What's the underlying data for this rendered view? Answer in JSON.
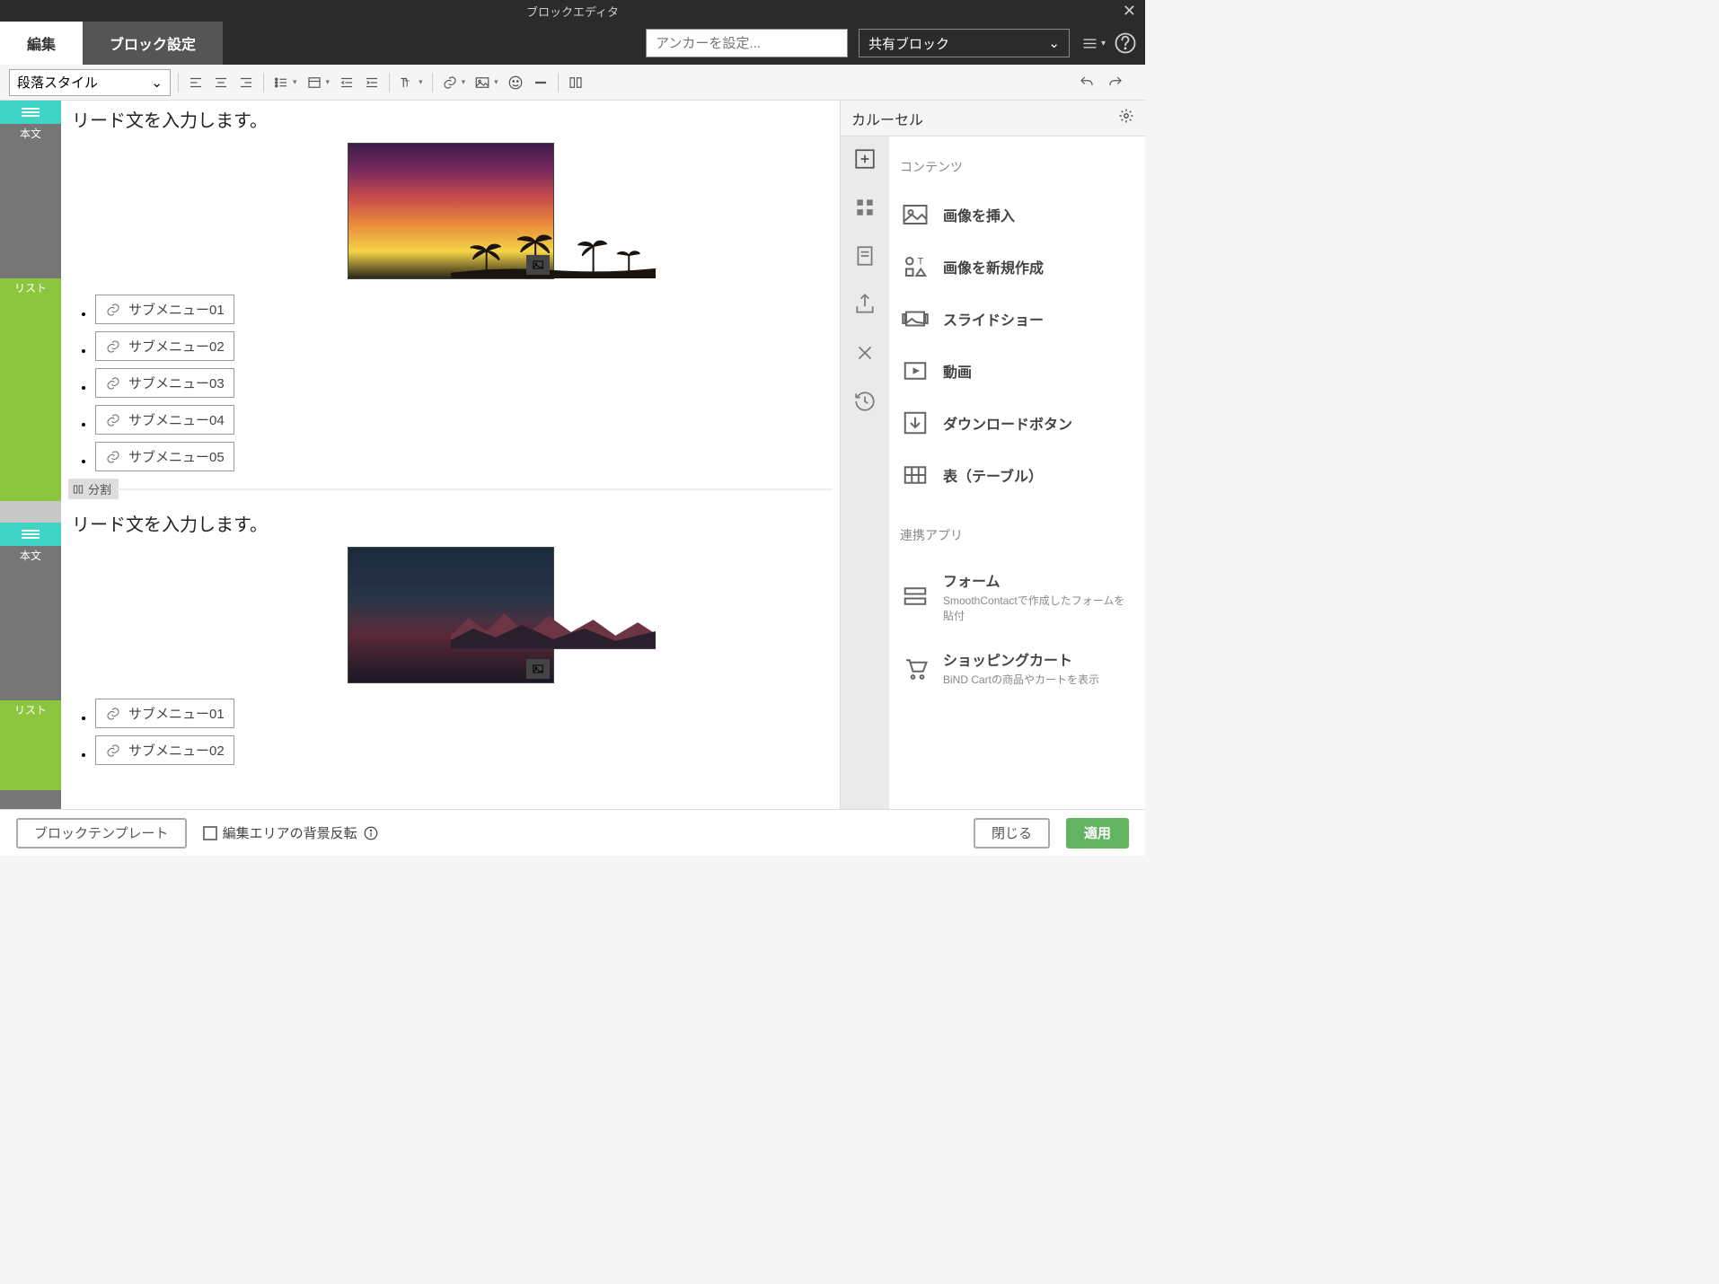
{
  "title": "ブロックエディタ",
  "tabs": {
    "edit": "編集",
    "block": "ブロック設定"
  },
  "anchor_placeholder": "アンカーを設定...",
  "share_block": "共有ブロック",
  "para_style": "段落スタイル",
  "blocks": [
    {
      "gutter_body": "本文",
      "gutter_list": "リスト",
      "lead": "リード文を入力します。",
      "submenus": [
        "サブメニュー01",
        "サブメニュー02",
        "サブメニュー03",
        "サブメニュー04",
        "サブメニュー05"
      ]
    },
    {
      "gutter_body": "本文",
      "gutter_list": "リスト",
      "lead": "リード文を入力します。",
      "submenus": [
        "サブメニュー01",
        "サブメニュー02"
      ]
    }
  ],
  "split_label": "分割",
  "right": {
    "title": "カルーセル",
    "section_contents": "コンテンツ",
    "items": [
      {
        "title": "画像を挿入"
      },
      {
        "title": "画像を新規作成"
      },
      {
        "title": "スライドショー"
      },
      {
        "title": "動画"
      },
      {
        "title": "ダウンロードボタン"
      },
      {
        "title": "表（テーブル）"
      }
    ],
    "section_apps": "連携アプリ",
    "apps": [
      {
        "title": "フォーム",
        "sub": "SmoothContactで作成したフォームを貼付"
      },
      {
        "title": "ショッピングカート",
        "sub": "BiND Cartの商品やカートを表示"
      }
    ]
  },
  "footer": {
    "template": "ブロックテンプレート",
    "invert": "編集エリアの背景反転",
    "close": "閉じる",
    "apply": "適用"
  }
}
